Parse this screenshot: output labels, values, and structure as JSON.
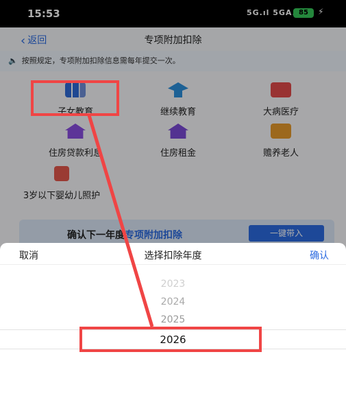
{
  "status_bar": {
    "time": "15:53",
    "network": "5G.ıl 5GA.ıl",
    "battery": "85"
  },
  "nav": {
    "back_label": "返回",
    "title": "专项附加扣除"
  },
  "notice": {
    "text": "按照规定，专项附加扣除信息需每年提交一次。"
  },
  "categories": [
    {
      "label": "子女教育",
      "icon": "books-icon"
    },
    {
      "label": "继续教育",
      "icon": "graduation-cap-icon"
    },
    {
      "label": "大病医疗",
      "icon": "medical-kit-icon"
    },
    {
      "label": "住房贷款利息",
      "icon": "house-loan-icon"
    },
    {
      "label": "住房租金",
      "icon": "house-rent-icon"
    },
    {
      "label": "赡养老人",
      "icon": "elder-icon"
    },
    {
      "label": "3岁以下婴幼儿照护",
      "icon": "baby-care-icon"
    }
  ],
  "banner": {
    "text_prefix": "确认下一年度",
    "text_highlight": "专项附加扣除",
    "button": "一键带入"
  },
  "sheet": {
    "cancel": "取消",
    "title": "选择扣除年度",
    "confirm": "确认",
    "years": [
      "2023",
      "2024",
      "2025",
      "2026"
    ],
    "selected": "2026"
  },
  "colors": {
    "accent": "#2c6be0",
    "highlight": "#f04545"
  }
}
